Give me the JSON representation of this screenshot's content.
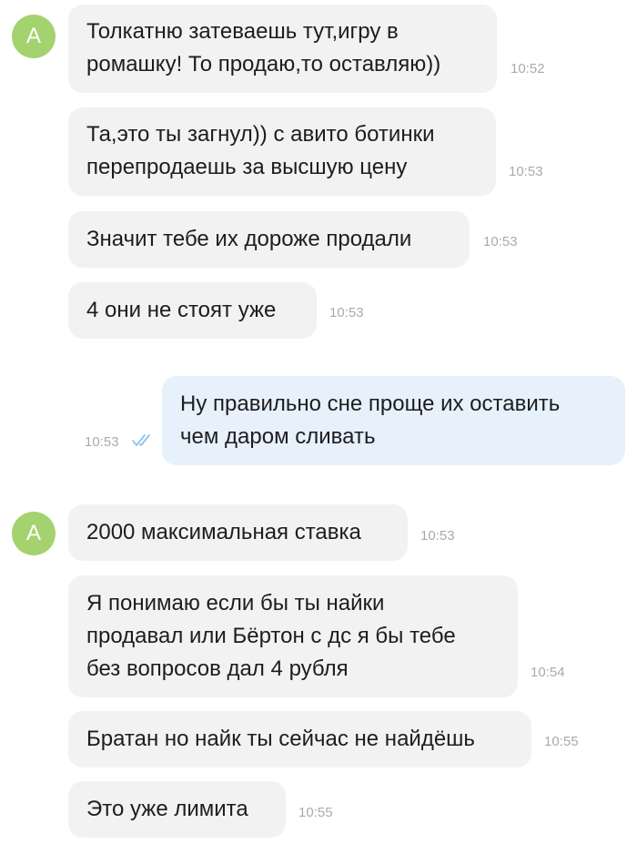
{
  "messages": [
    {
      "sender": "contact",
      "avatar_letter": "А",
      "lines": [
        "Толкатню затеваешь тут,игру в",
        "ромашку! То продаю,то оставляю))"
      ],
      "time": "10:52"
    },
    {
      "sender": "contact",
      "lines": [
        "Та,это ты загнул)) с авито ботинки",
        "перепродаешь за высшую цену"
      ],
      "time": "10:53"
    },
    {
      "sender": "contact",
      "lines": [
        "Значит тебе их дороже продали"
      ],
      "time": "10:53"
    },
    {
      "sender": "contact",
      "lines": [
        "4 они не стоят уже"
      ],
      "time": "10:53"
    },
    {
      "sender": "me",
      "lines": [
        "Ну правильно сне проще их оставить",
        "чем даром сливать"
      ],
      "time": "10:53",
      "status": "read-double-check"
    },
    {
      "sender": "contact",
      "avatar_letter": "А",
      "lines": [
        "2000 максимальная ставка"
      ],
      "time": "10:53"
    },
    {
      "sender": "contact",
      "lines": [
        "Я понимаю если бы ты найки",
        "продавал или Бёртон с дс я бы тебе",
        "без вопросов дал 4 рубля"
      ],
      "time": "10:54"
    },
    {
      "sender": "contact",
      "lines": [
        "Братан но найк ты сейчас не найдёшь"
      ],
      "time": "10:55"
    },
    {
      "sender": "contact",
      "lines": [
        "Это уже лимита"
      ],
      "time": "10:55"
    }
  ],
  "colors": {
    "avatar": "#a4d26f",
    "incoming_bubble": "#f2f2f2",
    "outgoing_bubble": "#e6f1fb",
    "timestamp": "#a6abb2",
    "read_check": "#8fc0ec"
  }
}
